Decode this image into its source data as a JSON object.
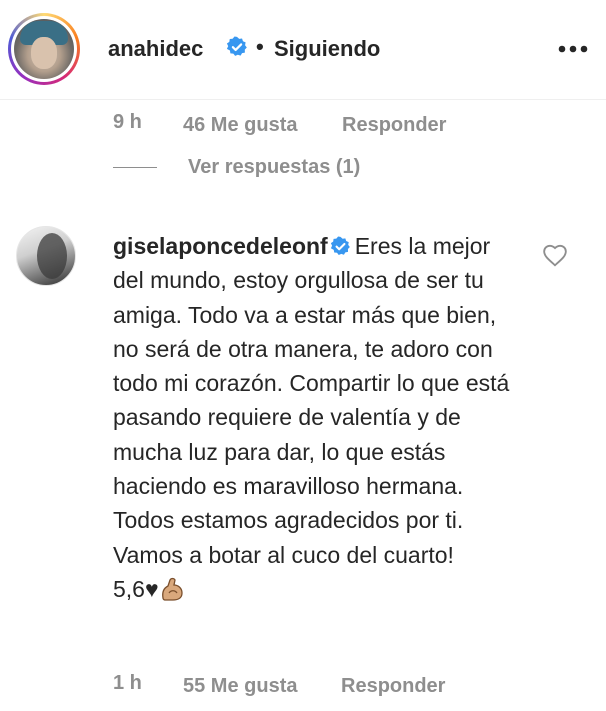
{
  "header": {
    "username": "anahidec",
    "separator": "•",
    "follow_status": "Siguiendo",
    "more_icon": "more-options-icon"
  },
  "previous_comment": {
    "time": "9 h",
    "likes": "46 Me gusta",
    "reply_label": "Responder",
    "view_replies": "Ver respuestas (1)"
  },
  "comment": {
    "username": "giselaponcedeleonf",
    "text": "Eres la mejor del mundo, estoy orgullosa de ser tu amiga. Todo va a estar más que bien, no será de otra manera, te adoro con todo mi corazón. Compartir lo que está pasando requiere de valentía y de mucha luz para dar, lo que estás haciendo es maravilloso hermana. Todos estamos agradecidos por ti. Vamos a botar al cuco del cuarto!",
    "suffix": "5,6♥",
    "time": "1 h",
    "likes": "55 Me gusta",
    "reply_label": "Responder"
  },
  "colors": {
    "verified_blue": "#3897f0",
    "meta_gray": "#8e8e8e",
    "text": "#262626"
  }
}
